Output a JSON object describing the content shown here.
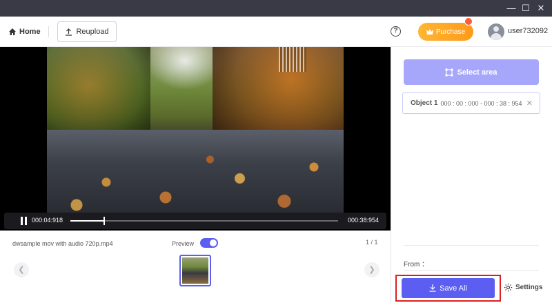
{
  "window": {
    "controls": [
      "minimize",
      "maximize",
      "close"
    ]
  },
  "header": {
    "home_label": "Home",
    "reupload_label": "Reupload",
    "purchase_label": "Purchase",
    "username": "user732092"
  },
  "player": {
    "current_time": "000:04:918",
    "total_time": "000:38:954",
    "progress": 0.126,
    "state": "playing"
  },
  "file_bar": {
    "file_name": "dwsample mov with audio 720p.mp4",
    "preview_label": "Preview",
    "preview_enabled": true,
    "page_indicator": "1 / 1"
  },
  "panel": {
    "select_area_label": "Select area",
    "objects": [
      {
        "name": "Object 1",
        "range": "000 : 00 : 000 - 000 : 38 : 954"
      }
    ],
    "from_label": "From ：",
    "save_all_label": "Save All",
    "settings_label": "Settings"
  },
  "colors": {
    "accent": "#5b5ef0",
    "accent_light": "#a6a7fb",
    "purchase": "#ffa726",
    "titlebar": "#3a3a46",
    "highlight": "#d92020"
  },
  "icons": [
    "home-icon",
    "upload-icon",
    "help-icon",
    "crown-icon",
    "user-avatar-icon",
    "pause-icon",
    "select-area-icon",
    "close-icon",
    "download-icon",
    "gear-icon",
    "chevron-left-icon",
    "chevron-right-icon"
  ]
}
